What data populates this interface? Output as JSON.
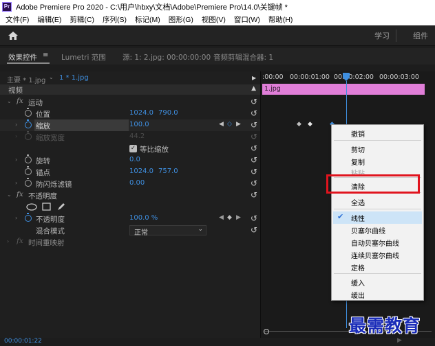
{
  "window": {
    "title": "Adobe Premiere Pro 2020 - C:\\用户\\hbxy\\文档\\Adobe\\Premiere Pro\\14.0\\关键帧 *",
    "app_icon": "Pr"
  },
  "menu": [
    "文件(F)",
    "编辑(E)",
    "剪辑(C)",
    "序列(S)",
    "标记(M)",
    "图形(G)",
    "视图(V)",
    "窗口(W)",
    "帮助(H)"
  ],
  "workspace": {
    "tabs": [
      "学习",
      "组件"
    ]
  },
  "panel_tabs": {
    "effects": "效果控件",
    "lumetri": "Lumetri 范围",
    "source": "源: 1: 2.jpg: 00:00:00:00",
    "mixer": "音频剪辑混合器: 1"
  },
  "clip_selector": {
    "master": "主要 * 1.jpg",
    "clip": "1 * 1.jpg"
  },
  "sections": {
    "video": "视频",
    "motion": "运动",
    "opacity_group": "不透明度",
    "time_remap": "时间重映射"
  },
  "properties": {
    "position": {
      "label": "位置",
      "x": "1024.0",
      "y": "790.0"
    },
    "scale": {
      "label": "缩放",
      "value": "100.0"
    },
    "scale_width": {
      "label": "缩放宽度",
      "value": "44.2"
    },
    "uniform_scale": "等比缩放",
    "rotation": {
      "label": "旋转",
      "value": "0.0"
    },
    "anchor": {
      "label": "锚点",
      "x": "1024.0",
      "y": "757.0"
    },
    "anti_flicker": {
      "label": "防闪烁滤镜",
      "value": "0.00"
    },
    "opacity": {
      "label": "不透明度",
      "value": "100.0 %"
    },
    "blend_mode": {
      "label": "混合模式",
      "value": "正常"
    }
  },
  "timeline": {
    "ticks": [
      ":00:00",
      "00:00:01:00",
      "00:00:02:00",
      "00:00:03:00"
    ],
    "clip_label": "1.jpg"
  },
  "context_menu": {
    "items": [
      {
        "label": "撤销",
        "disabled": false
      },
      {
        "label": "剪切",
        "disabled": false
      },
      {
        "label": "复制",
        "disabled": false
      },
      {
        "label": "粘贴",
        "disabled": true
      },
      {
        "label": "清除",
        "disabled": false
      },
      {
        "label": "全选",
        "disabled": false
      },
      {
        "label": "线性",
        "checked": true
      },
      {
        "label": "贝塞尔曲线"
      },
      {
        "label": "自动贝塞尔曲线"
      },
      {
        "label": "连续贝塞尔曲线"
      },
      {
        "label": "定格"
      },
      {
        "label": "缓入"
      },
      {
        "label": "缓出"
      }
    ]
  },
  "status": {
    "timecode": "00:00:01:22"
  },
  "watermark": "最需教育",
  "colors": {
    "accent_blue": "#3f8fe0",
    "clip_pink": "#e07ed8",
    "highlight_red": "#e0141e"
  }
}
